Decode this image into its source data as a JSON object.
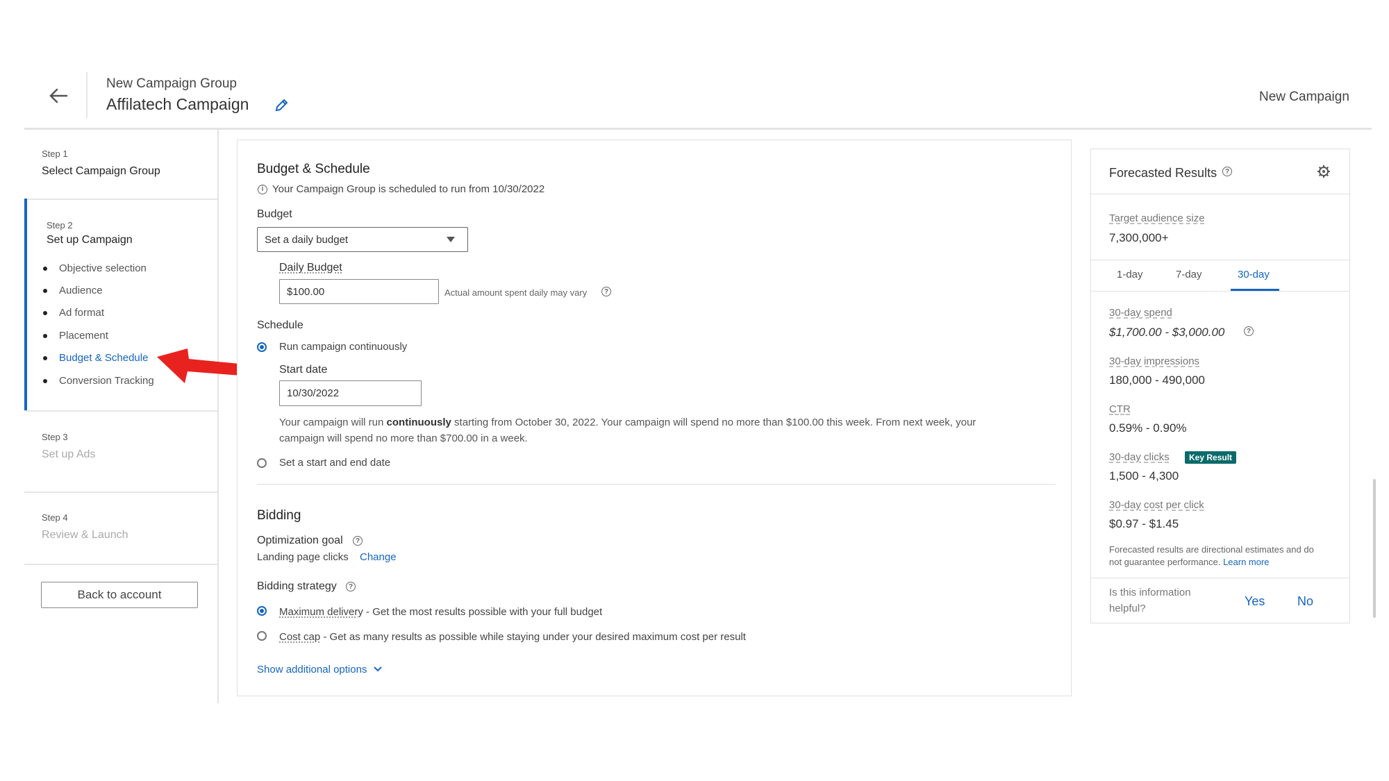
{
  "header": {
    "group_label": "New Campaign Group",
    "campaign_title": "Affilatech Campaign",
    "new_campaign": "New Campaign"
  },
  "steps": [
    {
      "step": "Step 1",
      "title": "Select Campaign Group"
    },
    {
      "step": "Step 2",
      "title": "Set up Campaign",
      "items": [
        "Objective selection",
        "Audience",
        "Ad format",
        "Placement",
        "Budget & Schedule",
        "Conversion Tracking"
      ]
    },
    {
      "step": "Step 3",
      "title": "Set up Ads"
    },
    {
      "step": "Step 4",
      "title": "Review & Launch"
    }
  ],
  "back_to_account": "Back to account",
  "budget_schedule": {
    "title": "Budget & Schedule",
    "notice": "Your Campaign Group is scheduled to run from 10/30/2022",
    "budget_label": "Budget",
    "budget_select": "Set a daily budget",
    "daily_budget_label": "Daily Budget",
    "daily_budget_value": "$100.00",
    "daily_note": "Actual amount spent daily may vary",
    "schedule_label": "Schedule",
    "run_continuously": "Run campaign continuously",
    "start_date_label": "Start date",
    "start_date_value": "10/30/2022",
    "run_desc_1a": "Your campaign will run ",
    "run_desc_1b": "continuously",
    "run_desc_1c": " starting from October 30, 2022. Your campaign will spend no more than $100.00 this week. From next week, your",
    "run_desc_2": "campaign will spend no more than $700.00 in a week.",
    "start_end": "Set a start and end date"
  },
  "bidding": {
    "title": "Bidding",
    "optimization_goal": "Optimization goal",
    "goal_value": "Landing page clicks",
    "change": "Change",
    "strategy_label": "Bidding strategy",
    "max_delivery": "Maximum delivery",
    "max_delivery_desc": " - Get the most results possible with your full budget",
    "cost_cap": "Cost cap",
    "cost_cap_desc": " - Get as many results as possible while staying under your desired maximum cost per result",
    "show_more": "Show additional options"
  },
  "forecast": {
    "title": "Forecasted Results",
    "audience_label": "Target audience size",
    "audience_value": "7,300,000+",
    "tabs": [
      "1-day",
      "7-day",
      "30-day"
    ],
    "spend_label": "30-day spend",
    "spend_value": "$1,700.00 - $3,000.00",
    "impressions_label": "30-day impressions",
    "impressions_value": "180,000 - 490,000",
    "ctr_label": "CTR",
    "ctr_value": "0.59% - 0.90%",
    "clicks_label": "30-day clicks",
    "key_result": "Key Result",
    "clicks_value": "1,500 - 4,300",
    "cpc_label": "30-day cost per click",
    "cpc_value": "$0.97 - $1.45",
    "disclaimer_1": "Forecasted results are directional estimates and do",
    "disclaimer_2": "not guarantee performance. ",
    "learn_more": "Learn more",
    "helpful_1": "Is this information",
    "helpful_2": "helpful?",
    "yes": "Yes",
    "no": "No"
  },
  "colors": {
    "accent": "#1565c0",
    "badge": "#0b6a6a",
    "annotation_arrow": "#e8231f"
  }
}
